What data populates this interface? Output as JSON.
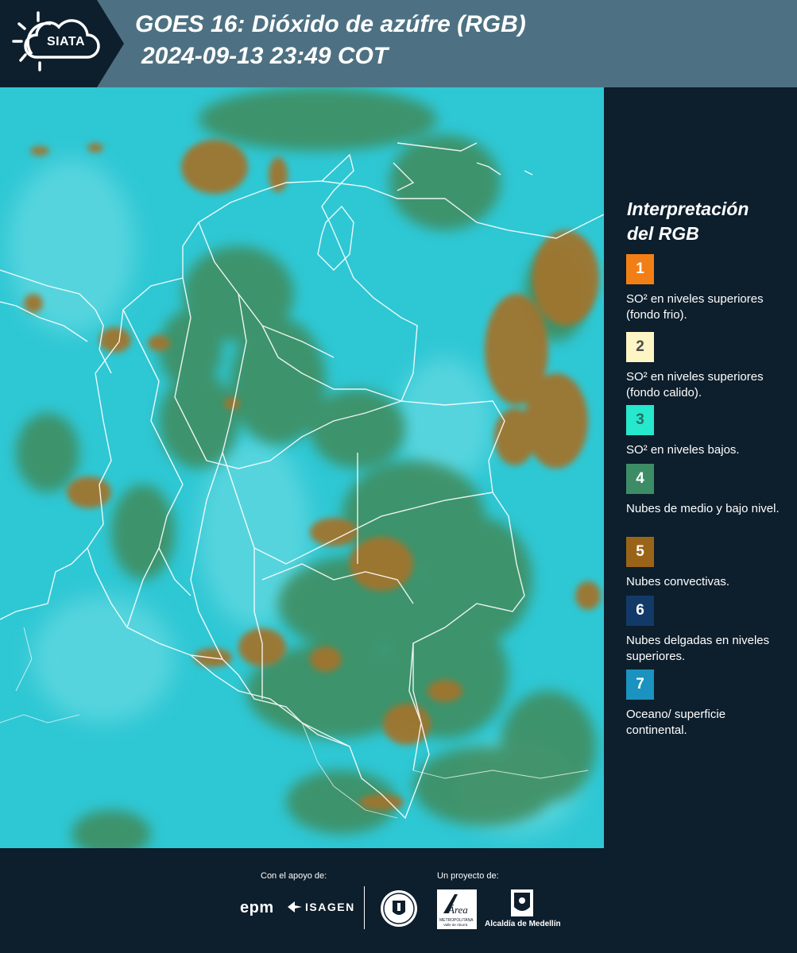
{
  "header": {
    "logo_text": "SIATA",
    "logo_icon": "sun-cloud-icon",
    "title": "GOES 16: Dióxido de azúfre (RGB)",
    "datetime": "2024-09-13 23:49 COT",
    "background_color": "#4d7182"
  },
  "map": {
    "description_colors": {
      "background_surface": "#2ec7d4",
      "mid_low_clouds": "#3f8a5a",
      "convective_clouds": "#a0742d",
      "borders": "#ffffff"
    }
  },
  "legend": {
    "title_line1": "Interpretación",
    "title_line2": "del RGB",
    "items": [
      {
        "number": "1",
        "label": "SO² en niveles superiores (fondo frio).",
        "color": "#f27f15",
        "text_color": "#ffffff"
      },
      {
        "number": "2",
        "label": "SO² en niveles superiores (fondo calido).",
        "color": "#fef5c4",
        "text_color": "#4b4b4b"
      },
      {
        "number": "3",
        "label": "SO² en niveles bajos.",
        "color": "#25e8cd",
        "text_color": "#2a6d66"
      },
      {
        "number": "4",
        "label": "Nubes de medio y bajo nivel.",
        "color": "#3c8d66",
        "text_color": "#ffffff"
      },
      {
        "number": "5",
        "label": "Nubes convectivas.",
        "color": "#9a6418",
        "text_color": "#ffffff"
      },
      {
        "number": "6",
        "label": "Nubes delgadas en niveles superiores.",
        "color": "#123a69",
        "text_color": "#ffffff"
      },
      {
        "number": "7",
        "label": "Oceano/ superficie continental.",
        "color": "#1a93c0",
        "text_color": "#ffffff"
      }
    ]
  },
  "footer": {
    "support_label": "Con el apoyo de:",
    "project_label": "Un proyecto de:",
    "sponsor1": "epm",
    "sponsor2": "ISAGEN",
    "seal_icon": "medellin-seal-icon",
    "area_logo_text": "Área",
    "area_logo_subtext": "METROPOLITANA",
    "area_logo_subtext2": "Valle de Aburrá",
    "alcaldia": "Alcaldía de Medellín"
  }
}
